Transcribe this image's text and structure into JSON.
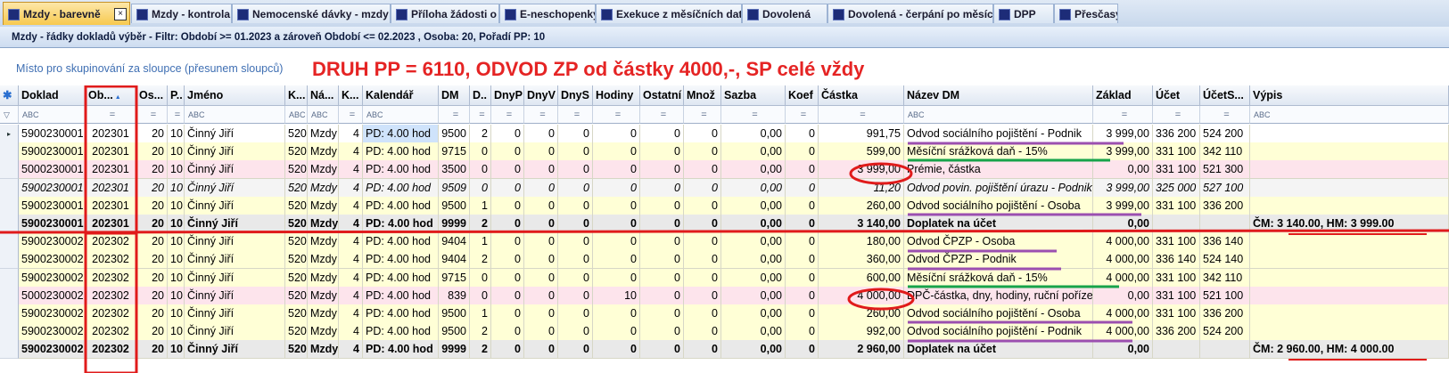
{
  "tabs": [
    {
      "label": "Mzdy - barevně",
      "active": true
    },
    {
      "label": "Mzdy - kontrola"
    },
    {
      "label": "Nemocenské dávky - mzdy"
    },
    {
      "label": "Příloha žádosti o"
    },
    {
      "label": "E-neschopenky"
    },
    {
      "label": "Exekuce z měsíčních dat"
    },
    {
      "label": "Dovolená"
    },
    {
      "label": "Dovolená - čerpání po měsících"
    },
    {
      "label": "DPP"
    },
    {
      "label": "Přesčasy"
    }
  ],
  "filter_text": "Mzdy - řádky dokladů výběr -  Filtr: Období >= 01.2023  a zároveň  Období <= 02.2023 , Osoba: 20, Pořadí PP: 10",
  "group_hint": "Místo pro skupinování za sloupce (přesunem sloupců)",
  "annotation": "DRUH PP = 6110, ODVOD ZP od částky 4000,-, SP celé vždy",
  "columns": [
    "Doklad",
    "Ob...",
    "Os...",
    "P..",
    "Jméno",
    "K...",
    "Ná...",
    "K...",
    "Kalendář",
    "DM",
    "D..",
    "DnyP",
    "DnyV",
    "DnyS",
    "Hodiny",
    "Ostatní",
    "Množ",
    "Sazba",
    "Koef",
    "Částka",
    "Název DM",
    "Základ",
    "Účet",
    "ÚčetS...",
    "Výpis"
  ],
  "filter_markers": [
    "ABC",
    "=",
    "=",
    "=",
    "ABC",
    "ABC",
    "ABC",
    "=",
    "ABC",
    "=",
    "=",
    "=",
    "=",
    "=",
    "=",
    "=",
    "=",
    "=",
    "=",
    "=",
    "ABC",
    "=",
    "=",
    "=",
    "ABC"
  ],
  "rows": [
    {
      "style": "current",
      "cells": [
        "5900230001",
        "202301",
        "20",
        "10",
        "Činný Jiří",
        "520",
        "Mzdy",
        "4",
        "PD: 4.00 hod",
        "9500",
        "2",
        "0",
        "0",
        "0",
        "0",
        "0",
        "0",
        "0,00",
        "0",
        "991,75",
        "Odvod sociálního pojištění - Podnik",
        "3 999,00",
        "336 200",
        "524 200",
        ""
      ]
    },
    {
      "style": "yellow",
      "cells": [
        "5900230001",
        "202301",
        "20",
        "10",
        "Činný Jiří",
        "520",
        "Mzdy",
        "4",
        "PD: 4.00 hod",
        "9715",
        "0",
        "0",
        "0",
        "0",
        "0",
        "0",
        "0",
        "0,00",
        "0",
        "599,00",
        "Měsíční srážková daň - 15%",
        "3 999,00",
        "331 100",
        "342 110",
        ""
      ]
    },
    {
      "style": "pink",
      "cells": [
        "5000230001",
        "202301",
        "20",
        "10",
        "Činný Jiří",
        "520",
        "Mzdy",
        "4",
        "PD: 4.00 hod",
        "3500",
        "0",
        "0",
        "0",
        "0",
        "0",
        "0",
        "0",
        "0,00",
        "0",
        "3 999,00",
        "Prémie, částka",
        "0,00",
        "331 100",
        "521 300",
        ""
      ]
    },
    {
      "style": "italic",
      "cells": [
        "5900230001",
        "202301",
        "20",
        "10",
        "Činný Jiří",
        "520",
        "Mzdy",
        "4",
        "PD: 4.00 hod",
        "9509",
        "0",
        "0",
        "0",
        "0",
        "0",
        "0",
        "0",
        "0,00",
        "0",
        "11,20",
        "Odvod povin. pojištění úrazu - Podnik",
        "3 999,00",
        "325 000",
        "527 100",
        ""
      ]
    },
    {
      "style": "yellow",
      "cells": [
        "5900230001",
        "202301",
        "20",
        "10",
        "Činný Jiří",
        "520",
        "Mzdy",
        "4",
        "PD: 4.00 hod",
        "9500",
        "1",
        "0",
        "0",
        "0",
        "0",
        "0",
        "0",
        "0,00",
        "0",
        "260,00",
        "Odvod sociálního pojištění - Osoba",
        "3 999,00",
        "331 100",
        "336 200",
        ""
      ]
    },
    {
      "style": "total",
      "cells": [
        "5900230001",
        "202301",
        "20",
        "10",
        "Činný Jiří",
        "520",
        "Mzdy",
        "4",
        "PD: 4.00 hod",
        "9999",
        "2",
        "0",
        "0",
        "0",
        "0",
        "0",
        "0",
        "0,00",
        "0",
        "3 140,00",
        "Doplatek na účet",
        "0,00",
        "",
        "",
        "ČM: 3 140.00, HM: 3 999.00"
      ]
    },
    {
      "style": "yellow",
      "cells": [
        "5900230002",
        "202302",
        "20",
        "10",
        "Činný Jiří",
        "520",
        "Mzdy",
        "4",
        "PD: 4.00 hod",
        "9404",
        "1",
        "0",
        "0",
        "0",
        "0",
        "0",
        "0",
        "0,00",
        "0",
        "180,00",
        "Odvod ČPZP - Osoba",
        "4 000,00",
        "331 100",
        "336 140",
        ""
      ]
    },
    {
      "style": "yellow",
      "cells": [
        "5900230002",
        "202302",
        "20",
        "10",
        "Činný Jiří",
        "520",
        "Mzdy",
        "4",
        "PD: 4.00 hod",
        "9404",
        "2",
        "0",
        "0",
        "0",
        "0",
        "0",
        "0",
        "0,00",
        "0",
        "360,00",
        "Odvod ČPZP - Podnik",
        "4 000,00",
        "336 140",
        "524 140",
        ""
      ]
    },
    {
      "style": "yellow",
      "cells": [
        "5900230002",
        "202302",
        "20",
        "10",
        "Činný Jiří",
        "520",
        "Mzdy",
        "4",
        "PD: 4.00 hod",
        "9715",
        "0",
        "0",
        "0",
        "0",
        "0",
        "0",
        "0",
        "0,00",
        "0",
        "600,00",
        "Měsíční srážková daň - 15%",
        "4 000,00",
        "331 100",
        "342 110",
        ""
      ]
    },
    {
      "style": "pink",
      "cells": [
        "5000230002",
        "202302",
        "20",
        "10",
        "Činný Jiří",
        "520",
        "Mzdy",
        "4",
        "PD: 4.00 hod",
        "839",
        "0",
        "0",
        "0",
        "0",
        "10",
        "0",
        "0",
        "0,00",
        "0",
        "4 000,00",
        "DPČ-částka, dny, hodiny, ruční pořízení",
        "0,00",
        "331 100",
        "521 100",
        ""
      ]
    },
    {
      "style": "yellow",
      "cells": [
        "5900230002",
        "202302",
        "20",
        "10",
        "Činný Jiří",
        "520",
        "Mzdy",
        "4",
        "PD: 4.00 hod",
        "9500",
        "1",
        "0",
        "0",
        "0",
        "0",
        "0",
        "0",
        "0,00",
        "0",
        "260,00",
        "Odvod sociálního pojištění - Osoba",
        "4 000,00",
        "331 100",
        "336 200",
        ""
      ]
    },
    {
      "style": "yellow",
      "cells": [
        "5900230002",
        "202302",
        "20",
        "10",
        "Činný Jiří",
        "520",
        "Mzdy",
        "4",
        "PD: 4.00 hod",
        "9500",
        "2",
        "0",
        "0",
        "0",
        "0",
        "0",
        "0",
        "0,00",
        "0",
        "992,00",
        "Odvod sociálního pojištění - Podnik",
        "4 000,00",
        "336 200",
        "524 200",
        ""
      ]
    },
    {
      "style": "total",
      "cells": [
        "5900230002",
        "202302",
        "20",
        "10",
        "Činný Jiří",
        "520",
        "Mzdy",
        "4",
        "PD: 4.00 hod",
        "9999",
        "2",
        "0",
        "0",
        "0",
        "0",
        "0",
        "0",
        "0,00",
        "0",
        "2 960,00",
        "Doplatek na účet",
        "0,00",
        "",
        "",
        "ČM: 2 960.00, HM: 4 000.00"
      ]
    }
  ],
  "colors": {
    "row_yellow": "#ffffd6",
    "row_pink": "#fde4ec",
    "row_italic": "#f4f4f4",
    "row_total": "#e9e9e9",
    "selection": "#cfe3fb",
    "markup_red": "#e01b1b",
    "underline_purple": "#9b4fb0",
    "underline_green": "#17a34a"
  }
}
